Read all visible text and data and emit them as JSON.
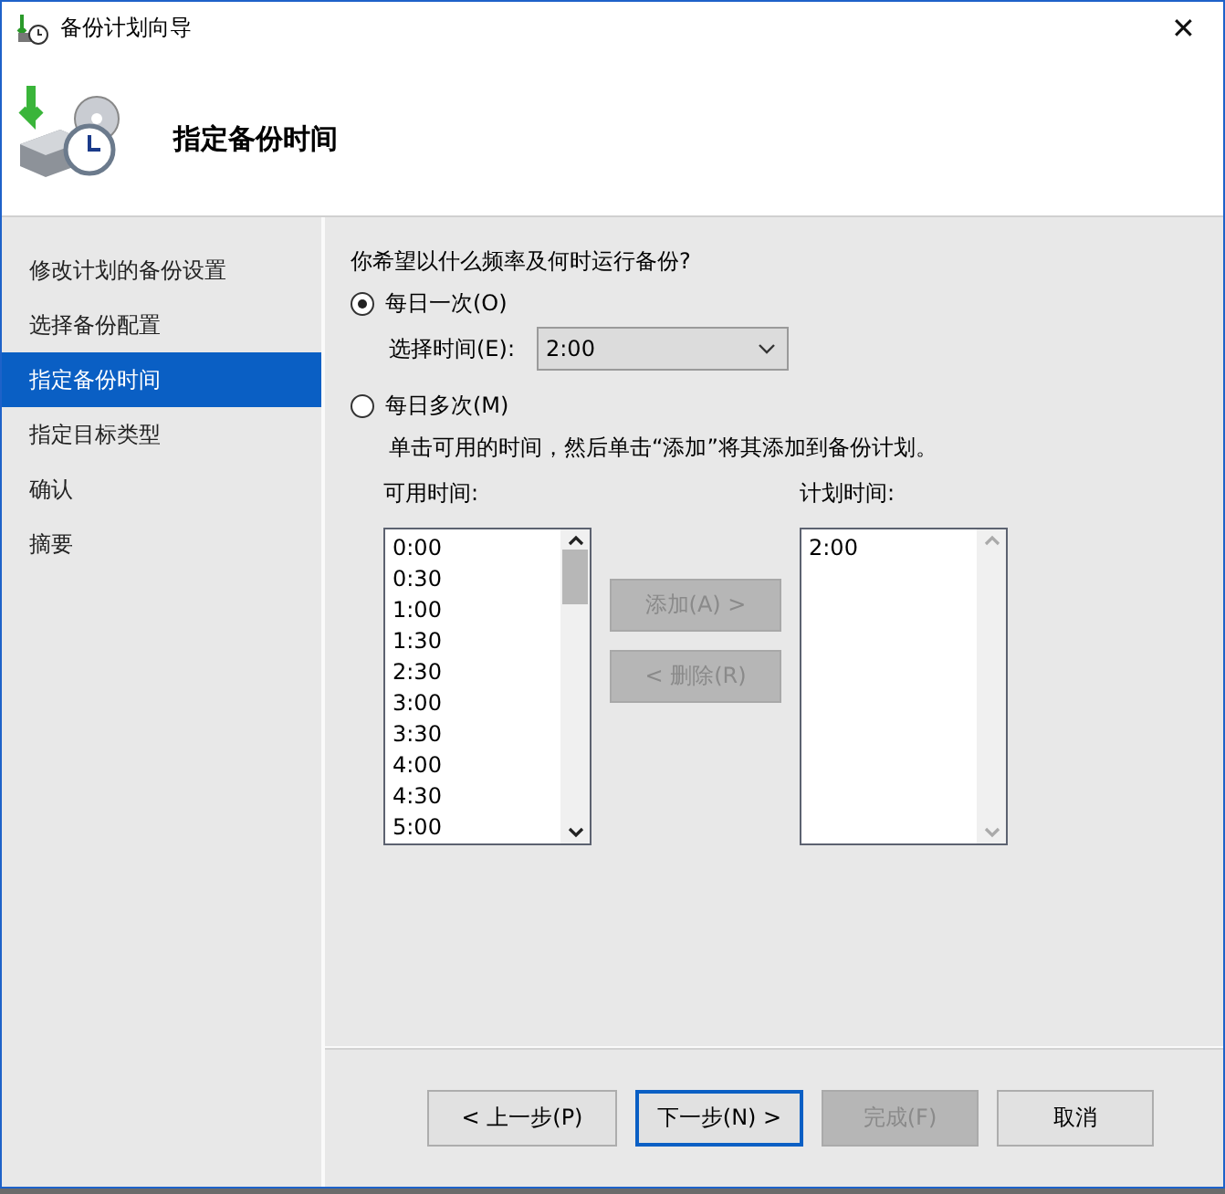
{
  "window": {
    "title": "备份计划向导",
    "close": "✕"
  },
  "header": {
    "title": "指定备份时间"
  },
  "sidebar": {
    "items": [
      {
        "label": "修改计划的备份设置",
        "selected": false
      },
      {
        "label": "选择备份配置",
        "selected": false
      },
      {
        "label": "指定备份时间",
        "selected": true
      },
      {
        "label": "指定目标类型",
        "selected": false
      },
      {
        "label": "确认",
        "selected": false
      },
      {
        "label": "摘要",
        "selected": false
      }
    ]
  },
  "question": "你希望以什么频率及何时运行备份?",
  "frequency": [
    {
      "label": "每日一次(O)",
      "selected": true
    },
    {
      "label": "每日多次(M)",
      "selected": false
    }
  ],
  "time_select": {
    "label": "选择时间(E):",
    "value": "2:00"
  },
  "instruction": "单击可用的时间，然后单击“添加”将其添加到备份计划。",
  "available": {
    "label": "可用时间:",
    "items": [
      "0:00",
      "0:30",
      "1:00",
      "1:30",
      "2:30",
      "3:00",
      "3:30",
      "4:00",
      "4:30",
      "5:00"
    ],
    "scrollable": true
  },
  "planned": {
    "label": "计划时间:",
    "items": [
      "2:00"
    ],
    "scrollable": false
  },
  "add_button": {
    "label": "添加(A) >",
    "disabled": true
  },
  "remove_button": {
    "label": "< 删除(R)",
    "disabled": true
  },
  "buttons": [
    {
      "label": "< 上一步(P)",
      "disabled": false,
      "focused": false
    },
    {
      "label": "下一步(N) >",
      "disabled": false,
      "focused": true
    },
    {
      "label": "完成(F)",
      "disabled": true,
      "focused": false
    },
    {
      "label": "取消",
      "disabled": false,
      "focused": false
    }
  ]
}
